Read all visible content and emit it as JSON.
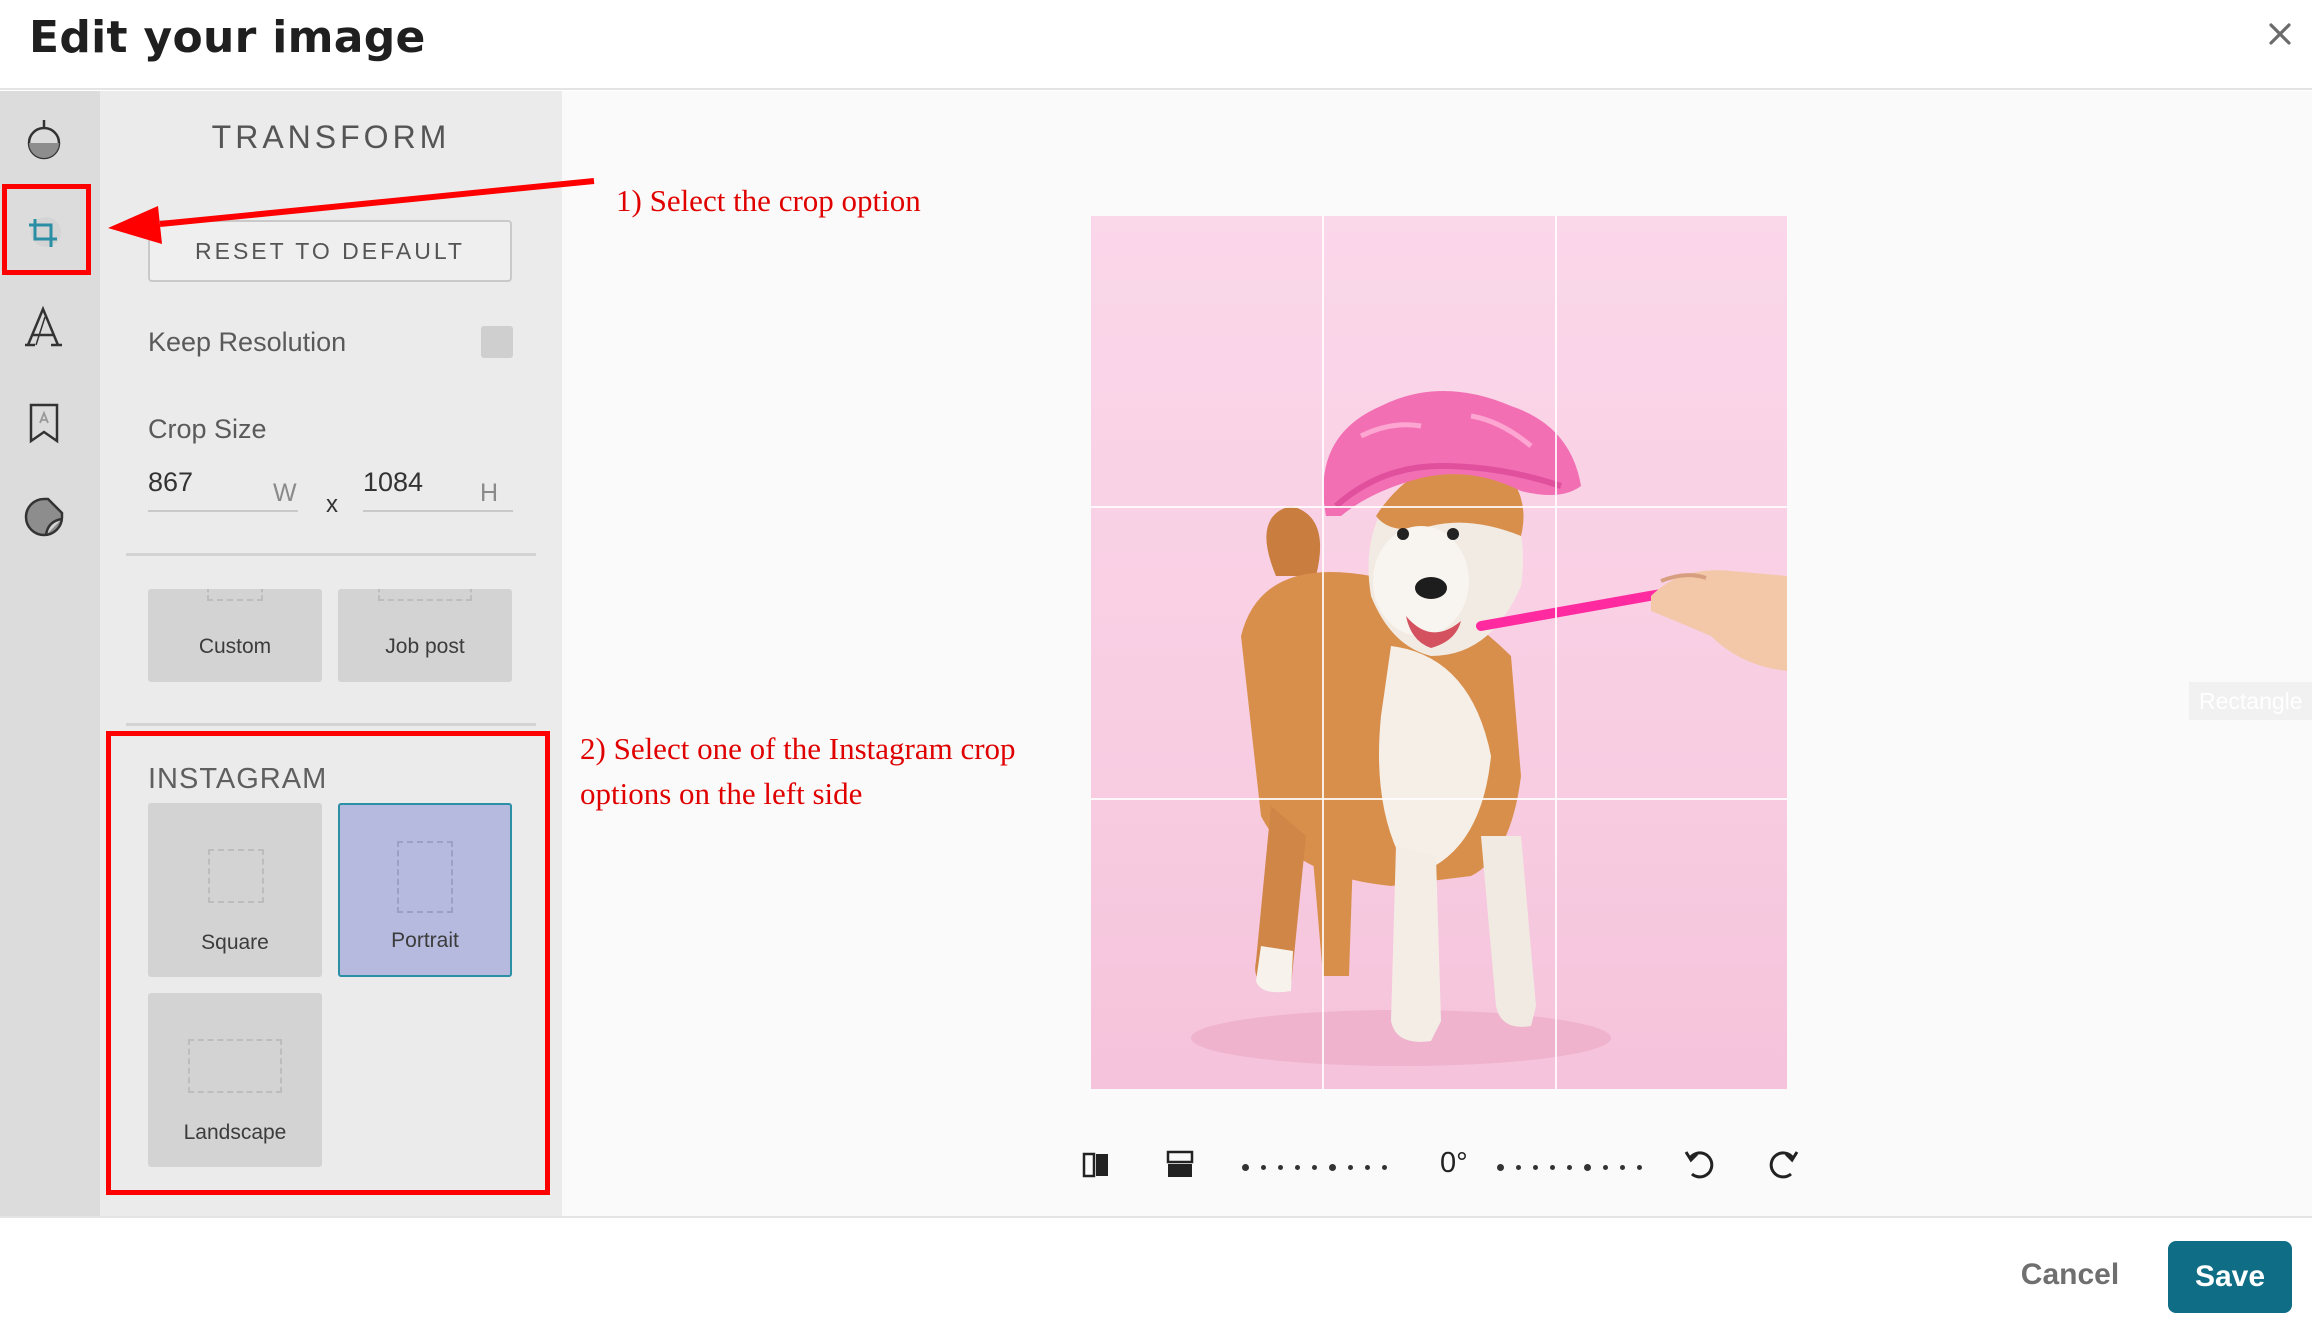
{
  "header": {
    "title": "Edit your image",
    "close_icon": "close-icon"
  },
  "rail": {
    "items": [
      {
        "icon": "adjust-icon"
      },
      {
        "icon": "crop-icon",
        "active": true
      },
      {
        "icon": "text-icon"
      },
      {
        "icon": "frame-icon"
      },
      {
        "icon": "sticker-icon"
      }
    ]
  },
  "panel": {
    "title": "TRANSFORM",
    "reset_label": "RESET TO DEFAULT",
    "keep_resolution_label": "Keep Resolution",
    "crop_size_label": "Crop Size",
    "width_value": "867",
    "width_unit": "W",
    "separator": "x",
    "height_value": "1084",
    "height_unit": "H",
    "presets": [
      {
        "label": "Custom"
      },
      {
        "label": "Job post"
      }
    ],
    "instagram_label": "INSTAGRAM",
    "instagram_presets": [
      {
        "label": "Square",
        "selected": false
      },
      {
        "label": "Portrait",
        "selected": true
      },
      {
        "label": "Landscape",
        "selected": false
      }
    ]
  },
  "canvas": {
    "ghost_label": "Rectangle",
    "angle": "0°",
    "tools": [
      "flip-horizontal-icon",
      "flip-vertical-icon",
      "rotate-left-icon",
      "rotate-right-icon"
    ]
  },
  "footer": {
    "cancel_label": "Cancel",
    "save_label": "Save"
  },
  "annotations": {
    "step1": "1) Select the crop option",
    "step2_line1": "2) Select one of the Instagram crop",
    "step2_line2": "options on the left side"
  },
  "colors": {
    "accent": "#0f6e86",
    "annotation": "#ff0000",
    "selected_tile": "#b5bade",
    "photo_bg": "#fbd7ea"
  }
}
